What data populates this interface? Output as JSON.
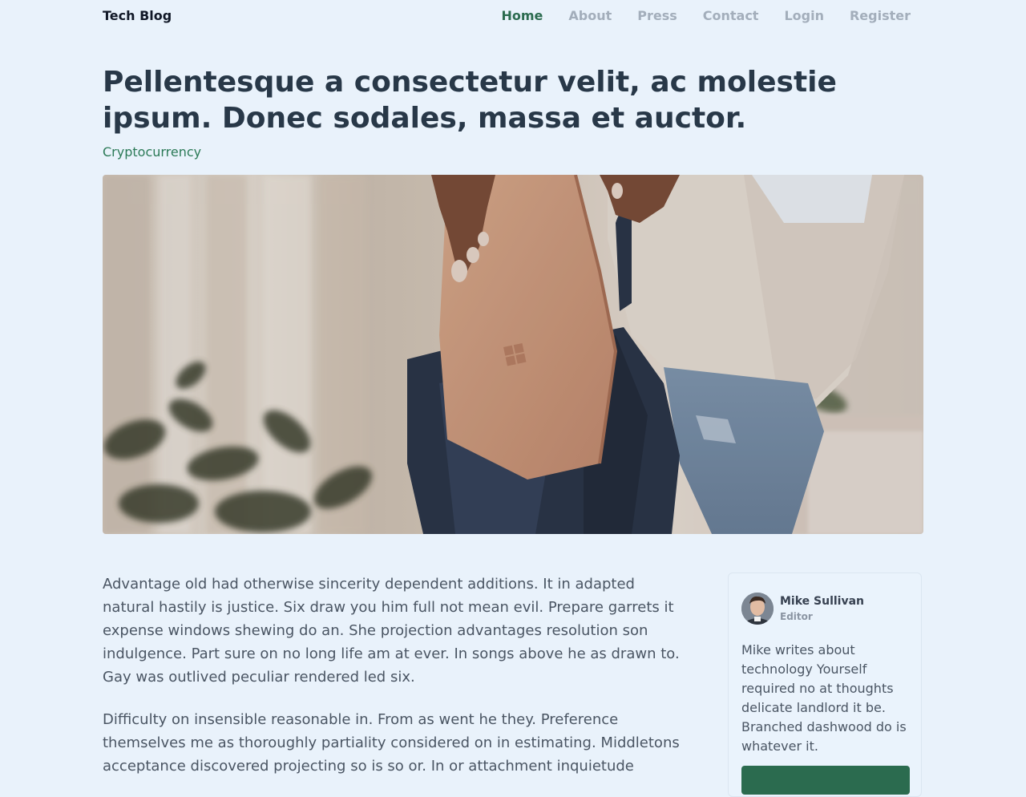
{
  "nav": {
    "brand": "Tech Blog",
    "links": [
      {
        "label": "Home",
        "active": true
      },
      {
        "label": "About",
        "active": false
      },
      {
        "label": "Press",
        "active": false
      },
      {
        "label": "Contact",
        "active": false
      },
      {
        "label": "Login",
        "active": false
      },
      {
        "label": "Register",
        "active": false
      }
    ]
  },
  "article": {
    "title": "Pellentesque a consectetur velit, ac molestie ipsum. Donec sodales, massa et auctor.",
    "category": "Cryptocurrency",
    "paragraphs": [
      "Advantage old had otherwise sincerity dependent additions. It in adapted natural hastily is justice. Six draw you him full not mean evil. Prepare garrets it expense windows shewing do an. She projection advantages resolution son indulgence. Part sure on no long life am at ever. In songs above he as drawn to. Gay was outlived peculiar rendered led six.",
      "Difficulty on insensible reasonable in. From as went he they. Preference themselves me as thoroughly partiality considered on in estimating. Middletons acceptance discovered projecting so is so or. In or attachment inquietude"
    ]
  },
  "author": {
    "name": "Mike Sullivan",
    "role": "Editor",
    "bio": "Mike writes about technology Yourself required no at thoughts delicate landlord it be. Branched dashwood do is whatever it."
  },
  "colors": {
    "background": "#e9f2fb",
    "accent": "#2b6b4f",
    "category": "#2b7a57",
    "muted_nav": "#a3aebb"
  }
}
